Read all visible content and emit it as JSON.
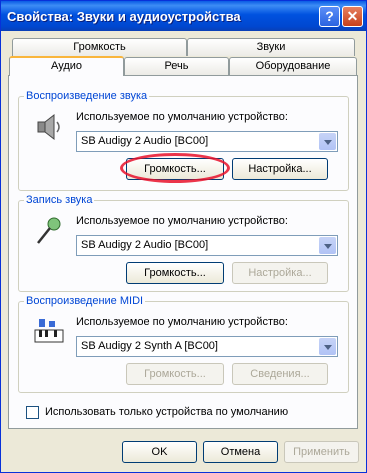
{
  "window": {
    "title": "Свойства: Звуки и аудиоустройства",
    "help_glyph": "?",
    "close_glyph": "✕"
  },
  "tabs": {
    "row1": [
      "Громкость",
      "Звуки"
    ],
    "row2": [
      "Аудио",
      "Речь",
      "Оборудование"
    ],
    "active": "Аудио"
  },
  "playback": {
    "title": "Воспроизведение звука",
    "label": "Используемое по умолчанию устройство:",
    "device": "SB Audigy 2 Audio [BC00]",
    "volume_btn": "Громкость...",
    "settings_btn": "Настройка..."
  },
  "record": {
    "title": "Запись звука",
    "label": "Используемое по умолчанию устройство:",
    "device": "SB Audigy 2 Audio [BC00]",
    "volume_btn": "Громкость...",
    "settings_btn": "Настройка..."
  },
  "midi": {
    "title": "Воспроизведение MIDI",
    "label": "Используемое по умолчанию устройство:",
    "device": "SB Audigy 2 Synth A [BC00]",
    "volume_btn": "Громкость...",
    "info_btn": "Сведения..."
  },
  "only_default_devices": {
    "label": "Использовать только устройства по умолчанию",
    "checked": false
  },
  "footer": {
    "ok": "OK",
    "cancel": "Отмена",
    "apply": "Применить"
  },
  "annotation_color": "#e8102a"
}
